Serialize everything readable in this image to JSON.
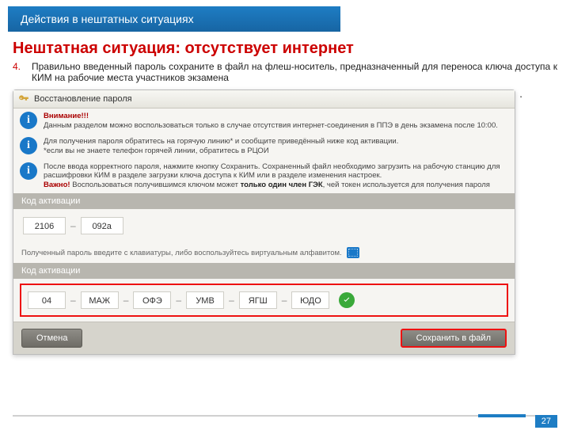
{
  "header": "Действия в нештатных ситуациях",
  "title": "Нештатная ситуация: отсутствует интернет",
  "step_num": "4.",
  "step_text": "Правильно введенный пароль сохраните в файл на флеш-носитель, предназначенный для переноса ключа доступа к КИМ на рабочие места участников экзамена",
  "window_title": "Восстановление пароля",
  "info1_title": "Внимание!!!",
  "info1_body": "Данным разделом можно воспользоваться только в случае отсутствия интернет-соединения в ППЭ в день экзамена после 10:00.",
  "info2_line1": "Для получения пароля обратитесь на горячую линию* и сообщите приведённый ниже код активации.",
  "info2_line2": "*если вы не знаете телефон горячей линии, обратитесь в РЦОИ",
  "info3_line1": "После ввода корректного пароля, нажмите кнопку Сохранить. Сохраненный файл необходимо загрузить на рабочую станцию для расшифровки КИМ в разделе загрузки ключа доступа к КИМ или в разделе изменения настроек.",
  "info3_prefix": "Важно!",
  "info3_line2": " Воспользоваться получившимся ключом может ",
  "info3_bold": "только один член ГЭК",
  "info3_line2b": ", чей токен используется для получения пароля",
  "code_section_label": "Код активации",
  "code1": "2106",
  "code2": "092a",
  "hint_text": "Полученный пароль введите с клавиатуры, либо воспользуйтесь виртуальным алфавитом.",
  "pass_section_label": "Код активации",
  "p1": "04",
  "p2": "МАЖ",
  "p3": "ОФЭ",
  "p4": "УМВ",
  "p5": "ЯГШ",
  "p6": "ЮДО",
  "cancel_label": "Отмена",
  "save_label": "Сохранить в файл",
  "page_number": "27"
}
